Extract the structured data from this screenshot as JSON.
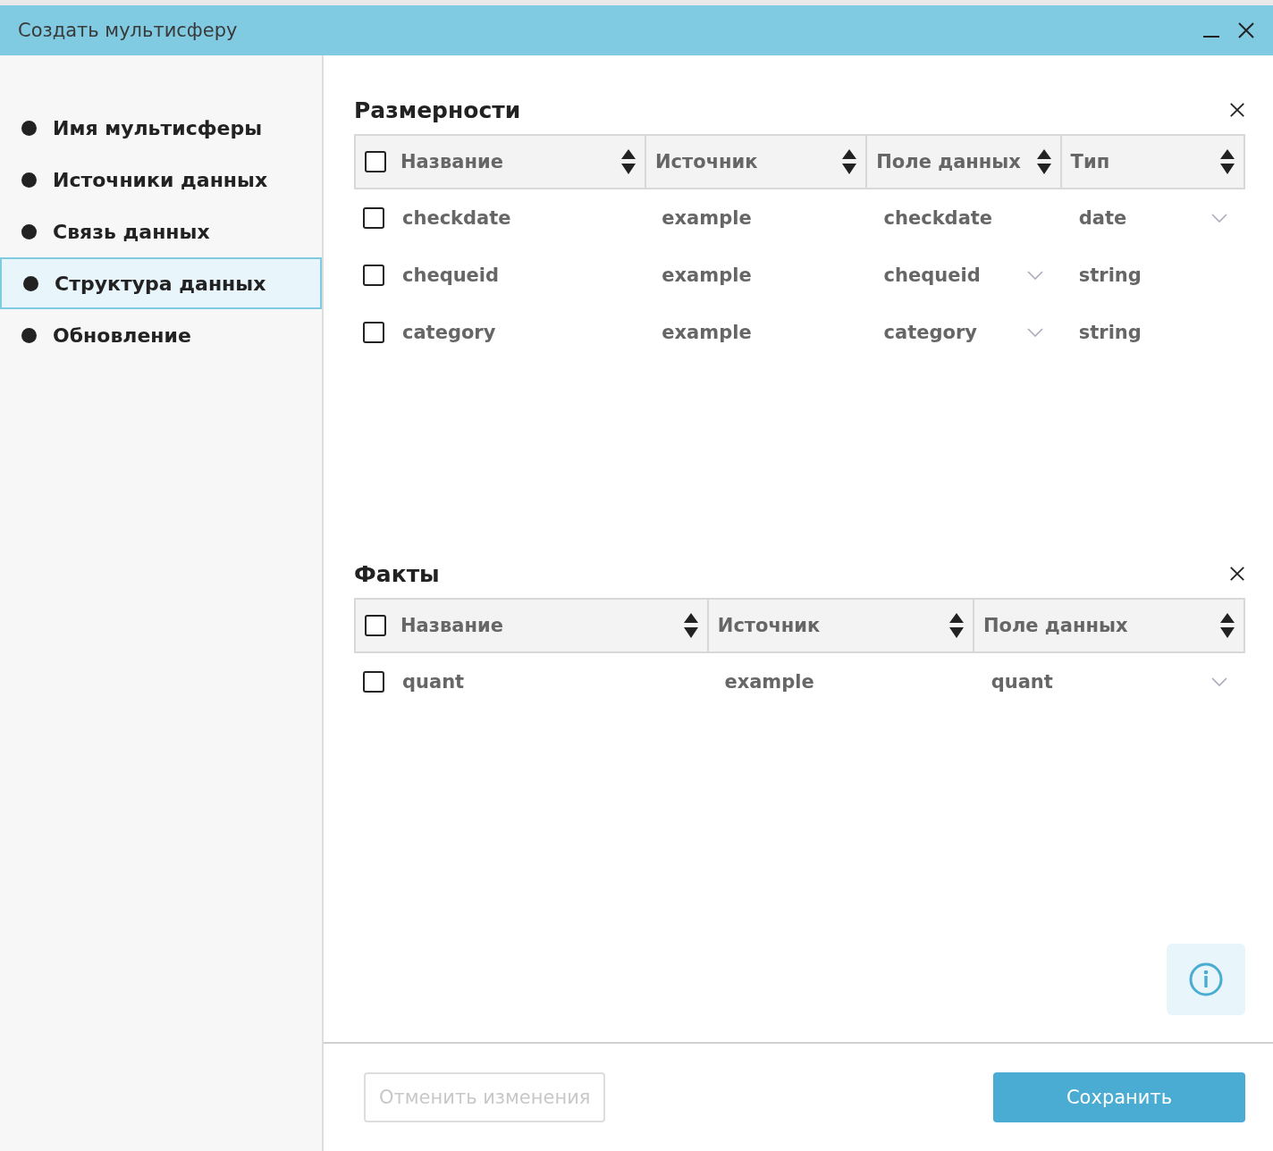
{
  "window": {
    "title": "Создать мультисферу"
  },
  "sidebar": {
    "items": [
      {
        "label": "Имя мультисферы",
        "selected": false
      },
      {
        "label": "Источники данных",
        "selected": false
      },
      {
        "label": "Связь данных",
        "selected": false
      },
      {
        "label": "Структура данных",
        "selected": true
      },
      {
        "label": "Обновление",
        "selected": false
      }
    ]
  },
  "sections": [
    {
      "title": "Размерности",
      "header_checked": false,
      "columns": [
        "Название",
        "Источник",
        "Поле данных",
        "Тип"
      ],
      "rows": [
        {
          "checked": false,
          "cells": [
            {
              "text": "checkdate",
              "dropdown": false
            },
            {
              "text": "example",
              "dropdown": false
            },
            {
              "text": "checkdate",
              "dropdown": false
            },
            {
              "text": "date",
              "dropdown": true
            }
          ]
        },
        {
          "checked": false,
          "cells": [
            {
              "text": "chequeid",
              "dropdown": false
            },
            {
              "text": "example",
              "dropdown": false
            },
            {
              "text": "chequeid",
              "dropdown": true
            },
            {
              "text": "string",
              "dropdown": false
            }
          ]
        },
        {
          "checked": false,
          "cells": [
            {
              "text": "category",
              "dropdown": false
            },
            {
              "text": "example",
              "dropdown": false
            },
            {
              "text": "category",
              "dropdown": true
            },
            {
              "text": "string",
              "dropdown": false
            }
          ]
        }
      ]
    },
    {
      "title": "Факты",
      "header_checked": false,
      "columns": [
        "Название",
        "Источник",
        "Поле данных"
      ],
      "rows": [
        {
          "checked": false,
          "cells": [
            {
              "text": "quant",
              "dropdown": false
            },
            {
              "text": "example",
              "dropdown": false
            },
            {
              "text": "quant",
              "dropdown": true
            }
          ]
        }
      ]
    }
  ],
  "footer": {
    "cancel": {
      "label": "Отменить изменения",
      "disabled": true
    },
    "save": {
      "label": "Сохранить",
      "disabled": false
    }
  }
}
